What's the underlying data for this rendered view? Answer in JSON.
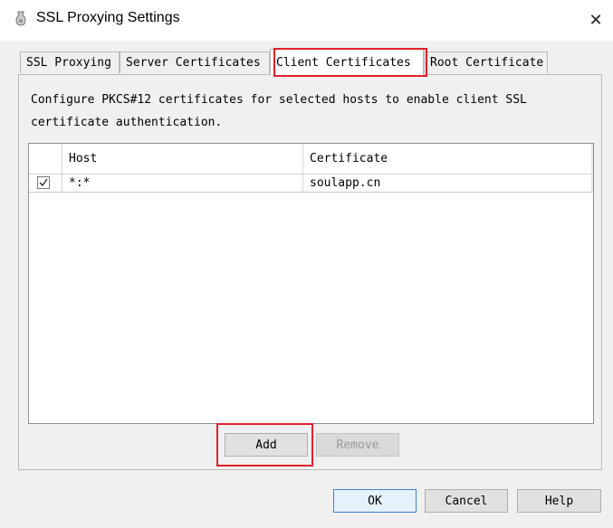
{
  "window": {
    "title": "SSL Proxying Settings",
    "app_icon": "charles-vase-icon",
    "close_glyph": "✕"
  },
  "tabs": [
    {
      "label": "SSL Proxying",
      "active": false
    },
    {
      "label": "Server Certificates",
      "active": false
    },
    {
      "label": "Client Certificates",
      "active": true
    },
    {
      "label": "Root Certificate",
      "active": false
    }
  ],
  "description": "Configure PKCS#12 certificates for selected hosts to enable client SSL certificate authentication.",
  "table": {
    "columns": [
      "",
      "Host",
      "Certificate"
    ],
    "rows": [
      {
        "enabled": true,
        "host": "*:*",
        "certificate": "soulapp.cn"
      }
    ]
  },
  "buttons": {
    "add": "Add",
    "remove": "Remove",
    "ok": "OK",
    "cancel": "Cancel",
    "help": "Help"
  },
  "highlight_color": "#e0202a"
}
